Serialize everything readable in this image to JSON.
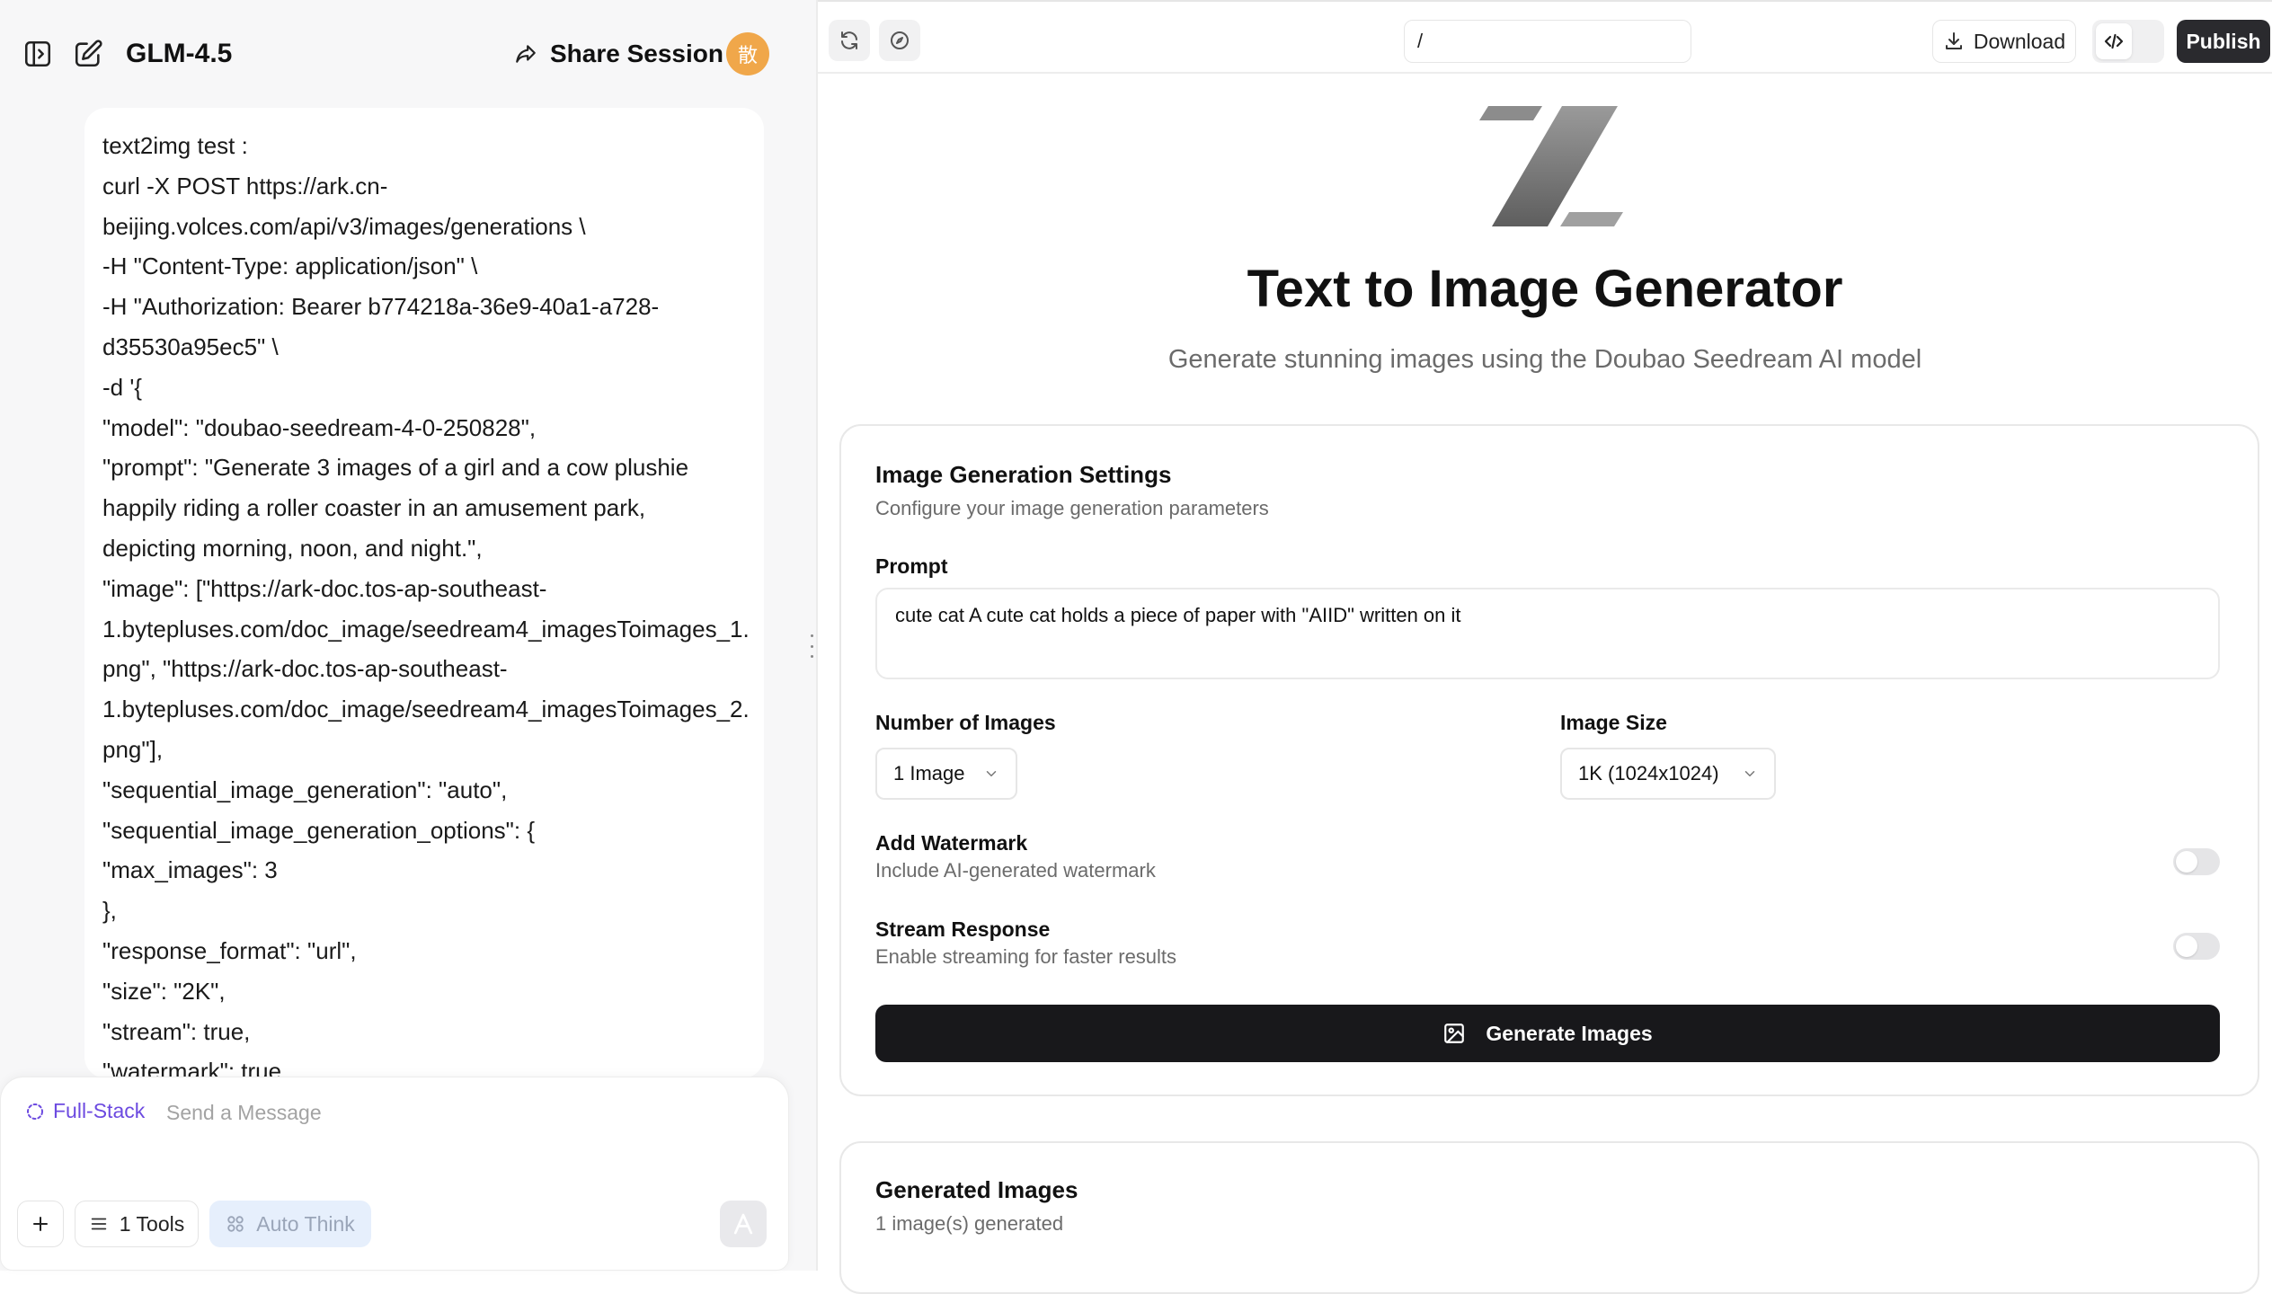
{
  "left": {
    "model_name": "GLM-4.5",
    "share_label": "Share Session",
    "avatar_char": "散",
    "message_lines": [
      "text2img test :",
      "curl -X POST https://ark.cn-",
      "beijing.volces.com/api/v3/images/generations \\",
      "-H \"Content-Type: application/json\" \\",
      "-H \"Authorization: Bearer b774218a-36e9-40a1-a728-",
      "d35530a95ec5\" \\",
      "-d '{",
      "\"model\": \"doubao-seedream-4-0-250828\",",
      "\"prompt\": \"Generate 3 images of a girl and a cow plushie",
      "happily riding a roller coaster in an amusement park,",
      "depicting morning, noon, and night.\",",
      "\"image\": [\"https://ark-doc.tos-ap-southeast-",
      "1.bytepluses.com/doc_image/seedream4_imagesToimages_1.",
      "png\", \"https://ark-doc.tos-ap-southeast-",
      "1.bytepluses.com/doc_image/seedream4_imagesToimages_2.",
      "png\"],",
      "\"sequential_image_generation\": \"auto\",",
      "\"sequential_image_generation_options\": {",
      "\"max_images\": 3",
      "},",
      "\"response_format\": \"url\",",
      "\"size\": \"2K\",",
      "\"stream\": true,",
      "\"watermark\": true"
    ],
    "composer": {
      "mode_label": "Full-Stack",
      "placeholder": "Send a Message",
      "tools_label": "1 Tools",
      "auto_think_label": "Auto Think",
      "send_glyph": "A"
    }
  },
  "preview": {
    "url": "/",
    "download_label": "Download",
    "publish_label": "Publish"
  },
  "app": {
    "title": "Text to Image Generator",
    "subtitle": "Generate stunning images using the Doubao Seedream AI model",
    "settings": {
      "title": "Image Generation Settings",
      "description": "Configure your image generation parameters",
      "prompt_label": "Prompt",
      "prompt_value": "cute cat A cute cat holds a piece of paper with \"AIID\" written on it",
      "num_images_label": "Number of Images",
      "num_images_value": "1 Image",
      "image_size_label": "Image Size",
      "image_size_value": "1K (1024x1024)",
      "watermark_label": "Add Watermark",
      "watermark_desc": "Include AI-generated watermark",
      "stream_label": "Stream Response",
      "stream_desc": "Enable streaming for faster results",
      "generate_label": "Generate Images"
    },
    "results": {
      "title": "Generated Images",
      "count_text": "1 image(s) generated"
    }
  },
  "colors": {
    "accent_purple": "#6c4ae0",
    "avatar_orange": "#f0a74a",
    "primary_dark": "#18181b",
    "auto_think_bg": "#e6effc"
  }
}
